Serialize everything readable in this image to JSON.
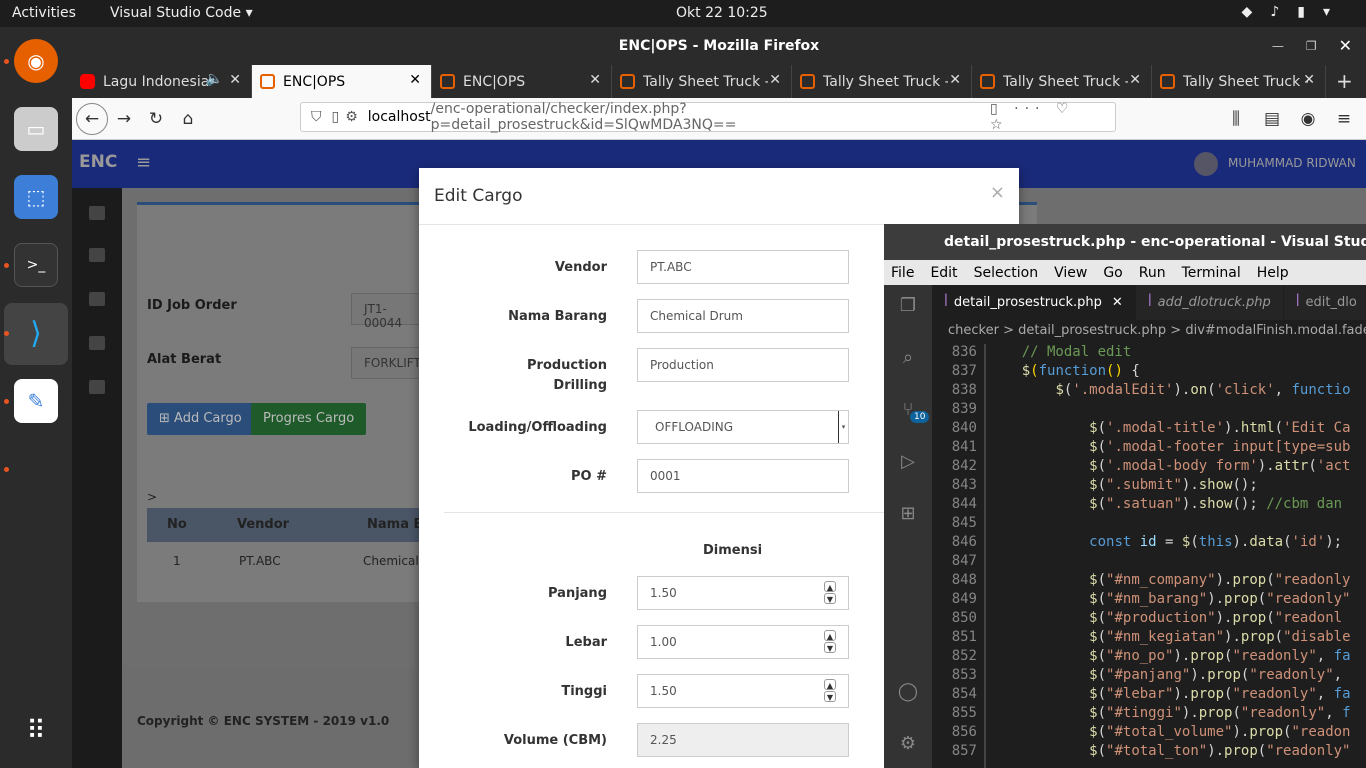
{
  "topbar": {
    "activities": "Activities",
    "app": "Visual Studio Code",
    "clock": "Okt 22  10:25"
  },
  "firefox": {
    "title": "ENC|OPS - Mozilla Firefox",
    "tabs": [
      {
        "label": "Lagu Indonesia",
        "icon": "youtube-icon"
      },
      {
        "label": "ENC|OPS",
        "icon": "enc-icon"
      },
      {
        "label": "ENC|OPS",
        "icon": "enc-icon"
      },
      {
        "label": "Tally Sheet Truck -",
        "icon": "enc-icon"
      },
      {
        "label": "Tally Sheet Truck -",
        "icon": "enc-icon"
      },
      {
        "label": "Tally Sheet Truck -",
        "icon": "enc-icon"
      },
      {
        "label": "Tally Sheet Truck -",
        "icon": "enc-icon"
      }
    ],
    "url_host": "localhost",
    "url_path": "/enc-operational/checker/index.php?p=detail_prosestruck&id=SlQwMDA3NQ=="
  },
  "app": {
    "logo": "ENC",
    "user": "MUHAMMAD RIDWAN",
    "id_job_label": "ID Job Order",
    "id_job_value": "JT1-00044",
    "alat_label": "Alat Berat",
    "alat_value": "FORKLIFT",
    "add_cargo": "Add Cargo",
    "progres_cargo": "Progres Cargo",
    "gt": ">",
    "table_headers": [
      "No",
      "Vendor",
      "Nama Ba"
    ],
    "table_row": [
      "1",
      "PT.ABC",
      "Chemical"
    ],
    "footer": "Copyright © ENC SYSTEM - 2019 v1.0"
  },
  "modal": {
    "title": "Edit Cargo",
    "close": "×",
    "vendor_label": "Vendor",
    "vendor": "PT.ABC",
    "nama_label": "Nama Barang",
    "nama": "Chemical Drum",
    "prod_label_1": "Production",
    "prod_label_2": "Drilling",
    "prod": "Production",
    "load_label": "Loading/Offloading",
    "load": "OFFLOADING",
    "po_label": "PO #",
    "po": "0001",
    "dimensi": "Dimensi",
    "panjang_label": "Panjang",
    "panjang": "1.50",
    "lebar_label": "Lebar",
    "lebar": "1.00",
    "tinggi_label": "Tinggi",
    "tinggi": "1.50",
    "volume_label": "Volume (CBM)",
    "volume": "2.25"
  },
  "vscode": {
    "title": "detail_prosestruck.php - enc-operational - Visual Studio Code",
    "menu": [
      "File",
      "Edit",
      "Selection",
      "View",
      "Go",
      "Run",
      "Terminal",
      "Help"
    ],
    "tabs": [
      "detail_prosestruck.php",
      "add_dlotruck.php",
      "edit_dlo"
    ],
    "crumb": "checker  >  detail_prosestruck.php  >  div#modalFinish.modal.fade",
    "badge": "10",
    "lines": [
      "836",
      "837",
      "838",
      "839",
      "840",
      "841",
      "842",
      "843",
      "844",
      "845",
      "846",
      "847",
      "848",
      "849",
      "850",
      "851",
      "852",
      "853",
      "854",
      "855",
      "856",
      "857"
    ]
  }
}
